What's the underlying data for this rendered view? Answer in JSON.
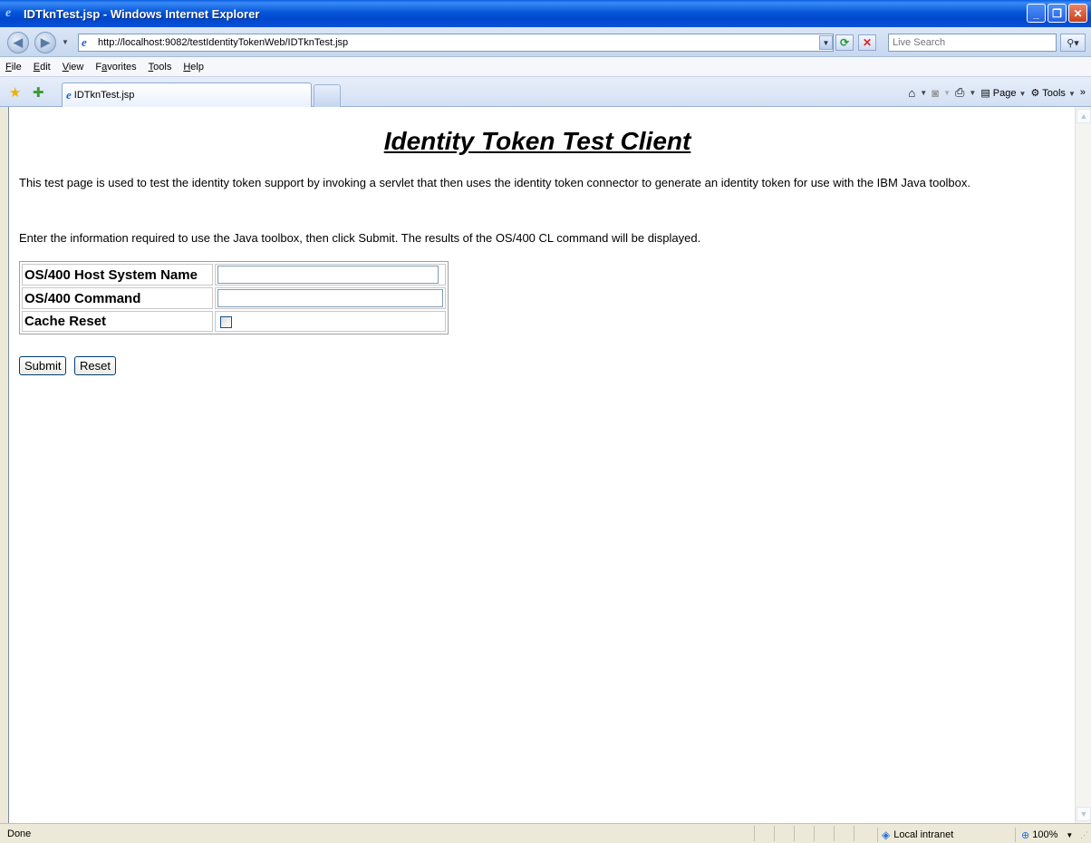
{
  "window": {
    "title": "IDTknTest.jsp - Windows Internet Explorer"
  },
  "address": {
    "url": "http://localhost:9082/testIdentityTokenWeb/IDTknTest.jsp",
    "search_placeholder": "Live Search"
  },
  "menu": {
    "items": [
      {
        "accel": "F",
        "rest": "ile"
      },
      {
        "accel": "E",
        "rest": "dit"
      },
      {
        "accel": "V",
        "rest": "iew"
      },
      {
        "pre": "F",
        "accel": "a",
        "rest": "vorites"
      },
      {
        "accel": "T",
        "rest": "ools"
      },
      {
        "accel": "H",
        "rest": "elp"
      }
    ]
  },
  "tabs": {
    "active_label": "IDTknTest.jsp"
  },
  "commandbar": {
    "page_label": "Page",
    "tools_label": "Tools"
  },
  "page": {
    "title": "Identity Token Test Client",
    "intro": "This test page is used to test the identity token support by invoking a servlet that then uses the identity token connector to generate an identity token for use with the IBM Java toolbox.",
    "instructions": "Enter the information required to use the Java toolbox, then click Submit. The results of the OS/400 CL command will be displayed.",
    "form": {
      "host_label": "OS/400 Host System Name",
      "host_value": "",
      "command_label": "OS/400 Command",
      "command_value": "",
      "cache_label": "Cache Reset",
      "cache_checked": false
    },
    "submit_label": "Submit",
    "reset_label": "Reset"
  },
  "status": {
    "text": "Done",
    "zone": "Local intranet",
    "zoom": "100%"
  }
}
